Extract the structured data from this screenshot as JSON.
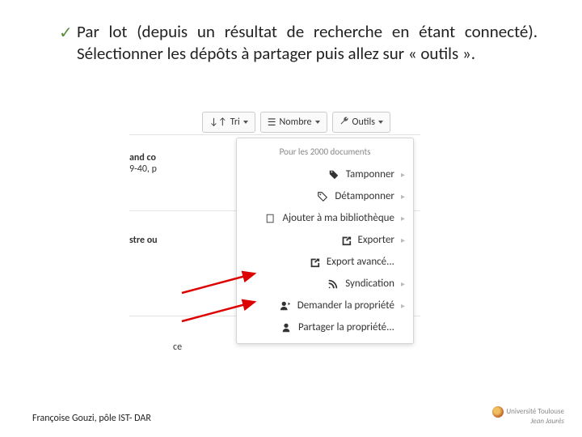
{
  "bullet": "Par lot (depuis un résultat de recherche en étant connecté). Sélectionner les dépôts à partager puis allez sur « outils ».",
  "toolbar": {
    "tri": "Tri",
    "nombre": "Nombre",
    "outils": "Outils"
  },
  "dropdown": {
    "header": "Pour les 2000 documents",
    "items": {
      "tamponner": "Tamponner",
      "detamponner": "Détamponner",
      "ajouter": "Ajouter à ma bibliothèque",
      "exporter": "Exporter",
      "export_avance": "Export avancé...",
      "syndication": "Syndication",
      "demander": "Demander la propriété",
      "partager": "Partager la propriété..."
    }
  },
  "fragments": {
    "and_co": "and co",
    "pages": "9-40, p",
    "stre": "stre ou",
    "ce": "ce"
  },
  "footer": "Françoise Gouzi, pôle IST- DAR",
  "logo": {
    "l1": "Université Toulouse",
    "l2": "Jean Jaurès"
  }
}
